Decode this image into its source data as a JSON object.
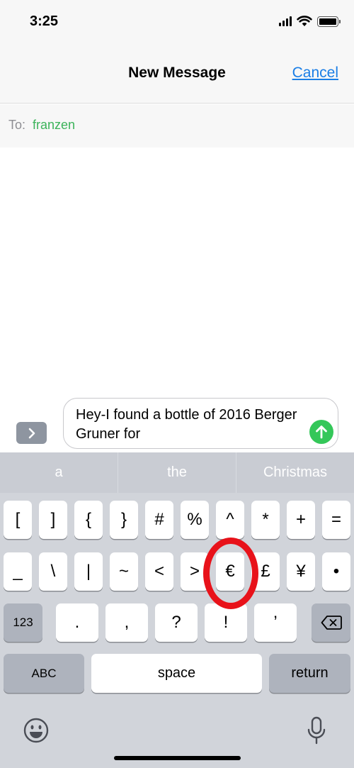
{
  "status_bar": {
    "time": "3:25",
    "icons": [
      "signal-icon",
      "wifi-icon",
      "battery-icon"
    ]
  },
  "nav": {
    "title": "New Message",
    "cancel_label": "Cancel"
  },
  "to_field": {
    "label": "To:",
    "recipient": "franzen"
  },
  "compose": {
    "expand_icon": "chevron-right-icon",
    "message_text": "Hey-I found a bottle of 2016 Berger Gruner for",
    "send_icon": "arrow-up-icon",
    "send_color": "#34c759"
  },
  "keyboard": {
    "suggestions": [
      "a",
      "the",
      "Christmas"
    ],
    "row1": [
      "[",
      "]",
      "{",
      "}",
      "#",
      "%",
      "^",
      "*",
      "+",
      "="
    ],
    "row2": [
      "_",
      "\\",
      "|",
      "~",
      "<",
      ">",
      "€",
      "£",
      "¥",
      "•"
    ],
    "row3": {
      "mode_label": "123",
      "keys": [
        ".",
        ",",
        "?",
        "!",
        "’"
      ],
      "delete_icon": "backspace-icon"
    },
    "row4": {
      "abc_label": "ABC",
      "space_label": "space",
      "return_label": "return"
    },
    "bottom": {
      "emoji_icon": "emoji-icon",
      "mic_icon": "microphone-icon"
    }
  },
  "annotation": {
    "highlighted_key": "€",
    "ring_color": "#e8121a"
  }
}
